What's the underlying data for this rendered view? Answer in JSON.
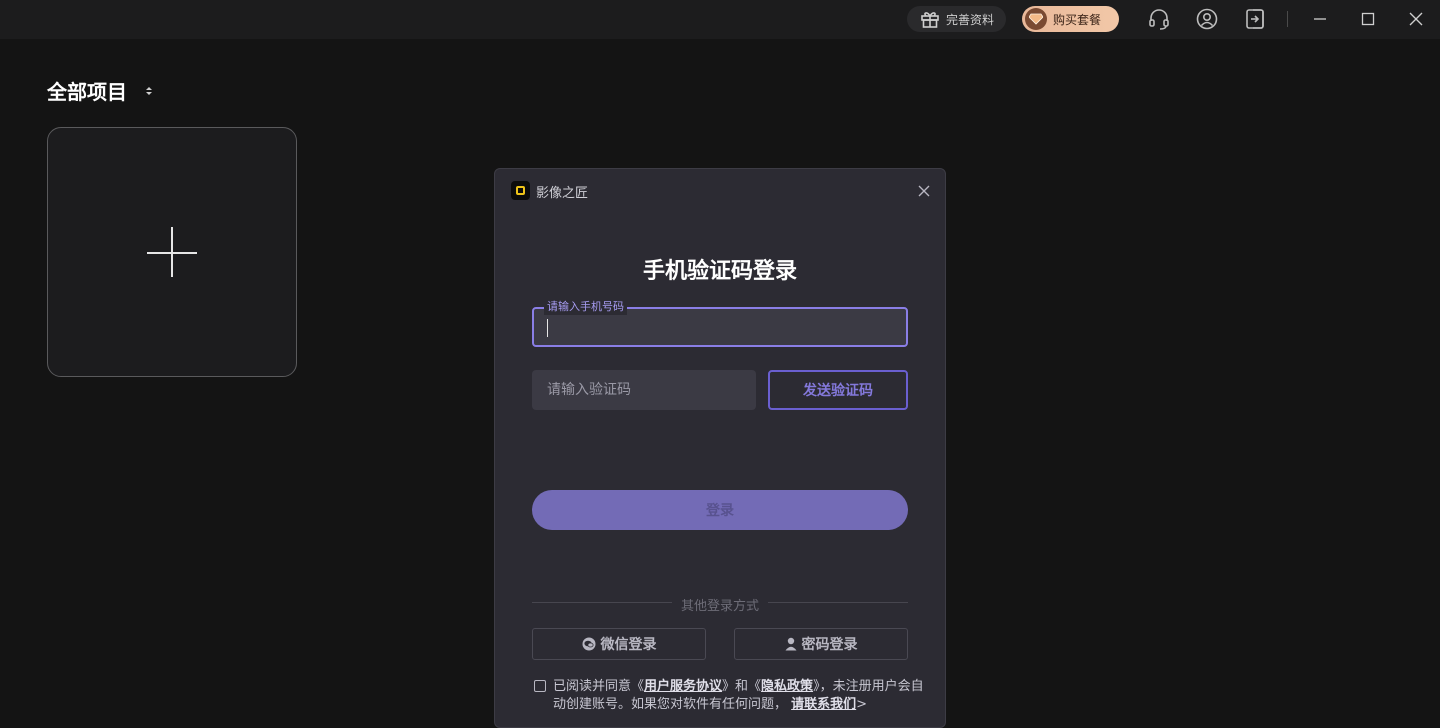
{
  "titlebar": {
    "gift_label": "完善资料",
    "buy_label": "购买套餐",
    "icons": [
      "headset-icon",
      "user-icon",
      "logout-icon",
      "minimize-icon",
      "maximize-icon",
      "close-icon"
    ]
  },
  "workspace": {
    "title": "全部项目"
  },
  "dialog": {
    "app_name": "影像之匠",
    "heading": "手机验证码登录",
    "phone_label": "请输入手机号码",
    "code_placeholder": "请输入验证码",
    "send_code_label": "发送验证码",
    "login_label": "登录",
    "other_methods": "其他登录方式",
    "wechat_login": "微信登录",
    "password_login": "密码登录",
    "agree": {
      "prefix": "已阅读并同意《",
      "service_agreement": "用户服务协议",
      "middle": "》和《",
      "privacy_policy": "隐私政策",
      "suffix": "》，未注册用户会自动创建账号。如果您对软件有任何问题，",
      "contact": "请联系我们",
      "arrow": ">"
    }
  },
  "colors": {
    "accent": "#8a7ee6",
    "login_button": "#736bb6",
    "buy_gradient": "#f2c8a8"
  }
}
